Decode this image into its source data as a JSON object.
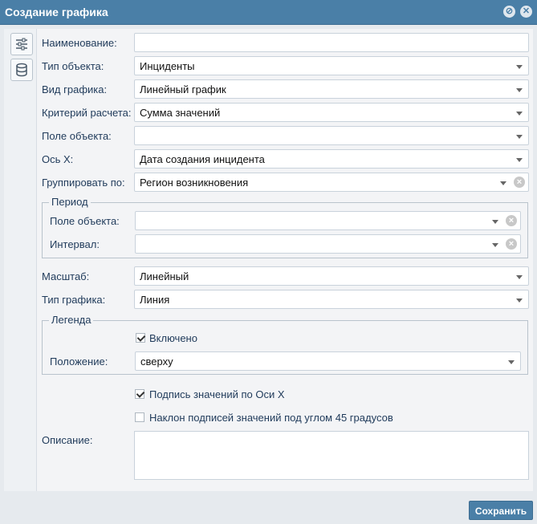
{
  "dialog": {
    "title": "Создание графика",
    "save_label": "Сохранить"
  },
  "fields": [
    {
      "label": "Наименование:",
      "value": ""
    },
    {
      "label": "Тип объекта:",
      "value": "Инциденты"
    },
    {
      "label": "Вид графика:",
      "value": "Линейный график"
    },
    {
      "label": "Критерий расчета:",
      "value": "Сумма значений"
    },
    {
      "label": "Поле объекта:",
      "value": ""
    },
    {
      "label": "Ось X:",
      "value": "Дата создания инцидента"
    },
    {
      "label": "Группировать по:",
      "value": "Регион возникновения"
    }
  ],
  "period": {
    "title": "Период",
    "field_label": "Поле объекта:",
    "field_value": "",
    "interval_label": "Интервал:",
    "interval_value": ""
  },
  "scale": {
    "label": "Масштаб:",
    "value": "Линейный"
  },
  "chart_type": {
    "label": "Тип графика:",
    "value": "Линия"
  },
  "legend": {
    "title": "Легенда",
    "enabled_label": "Включено",
    "enabled": true,
    "position_label": "Положение:",
    "position_value": "сверху"
  },
  "options": {
    "x_labels": "Подпись значений по Оси X",
    "x_labels_checked": true,
    "tilt_labels": "Наклон подписей значений под углом 45 градусов",
    "tilt_labels_checked": false
  },
  "description": {
    "label": "Описание:",
    "value": ""
  },
  "colors": {
    "accent": "#4a7fa7",
    "text": "#1f3a5a"
  },
  "icons": [
    "settings-icon",
    "database-icon",
    "minimize-icon",
    "close-icon",
    "dropdown-arrow-icon",
    "clear-icon",
    "checkmark-icon"
  ]
}
